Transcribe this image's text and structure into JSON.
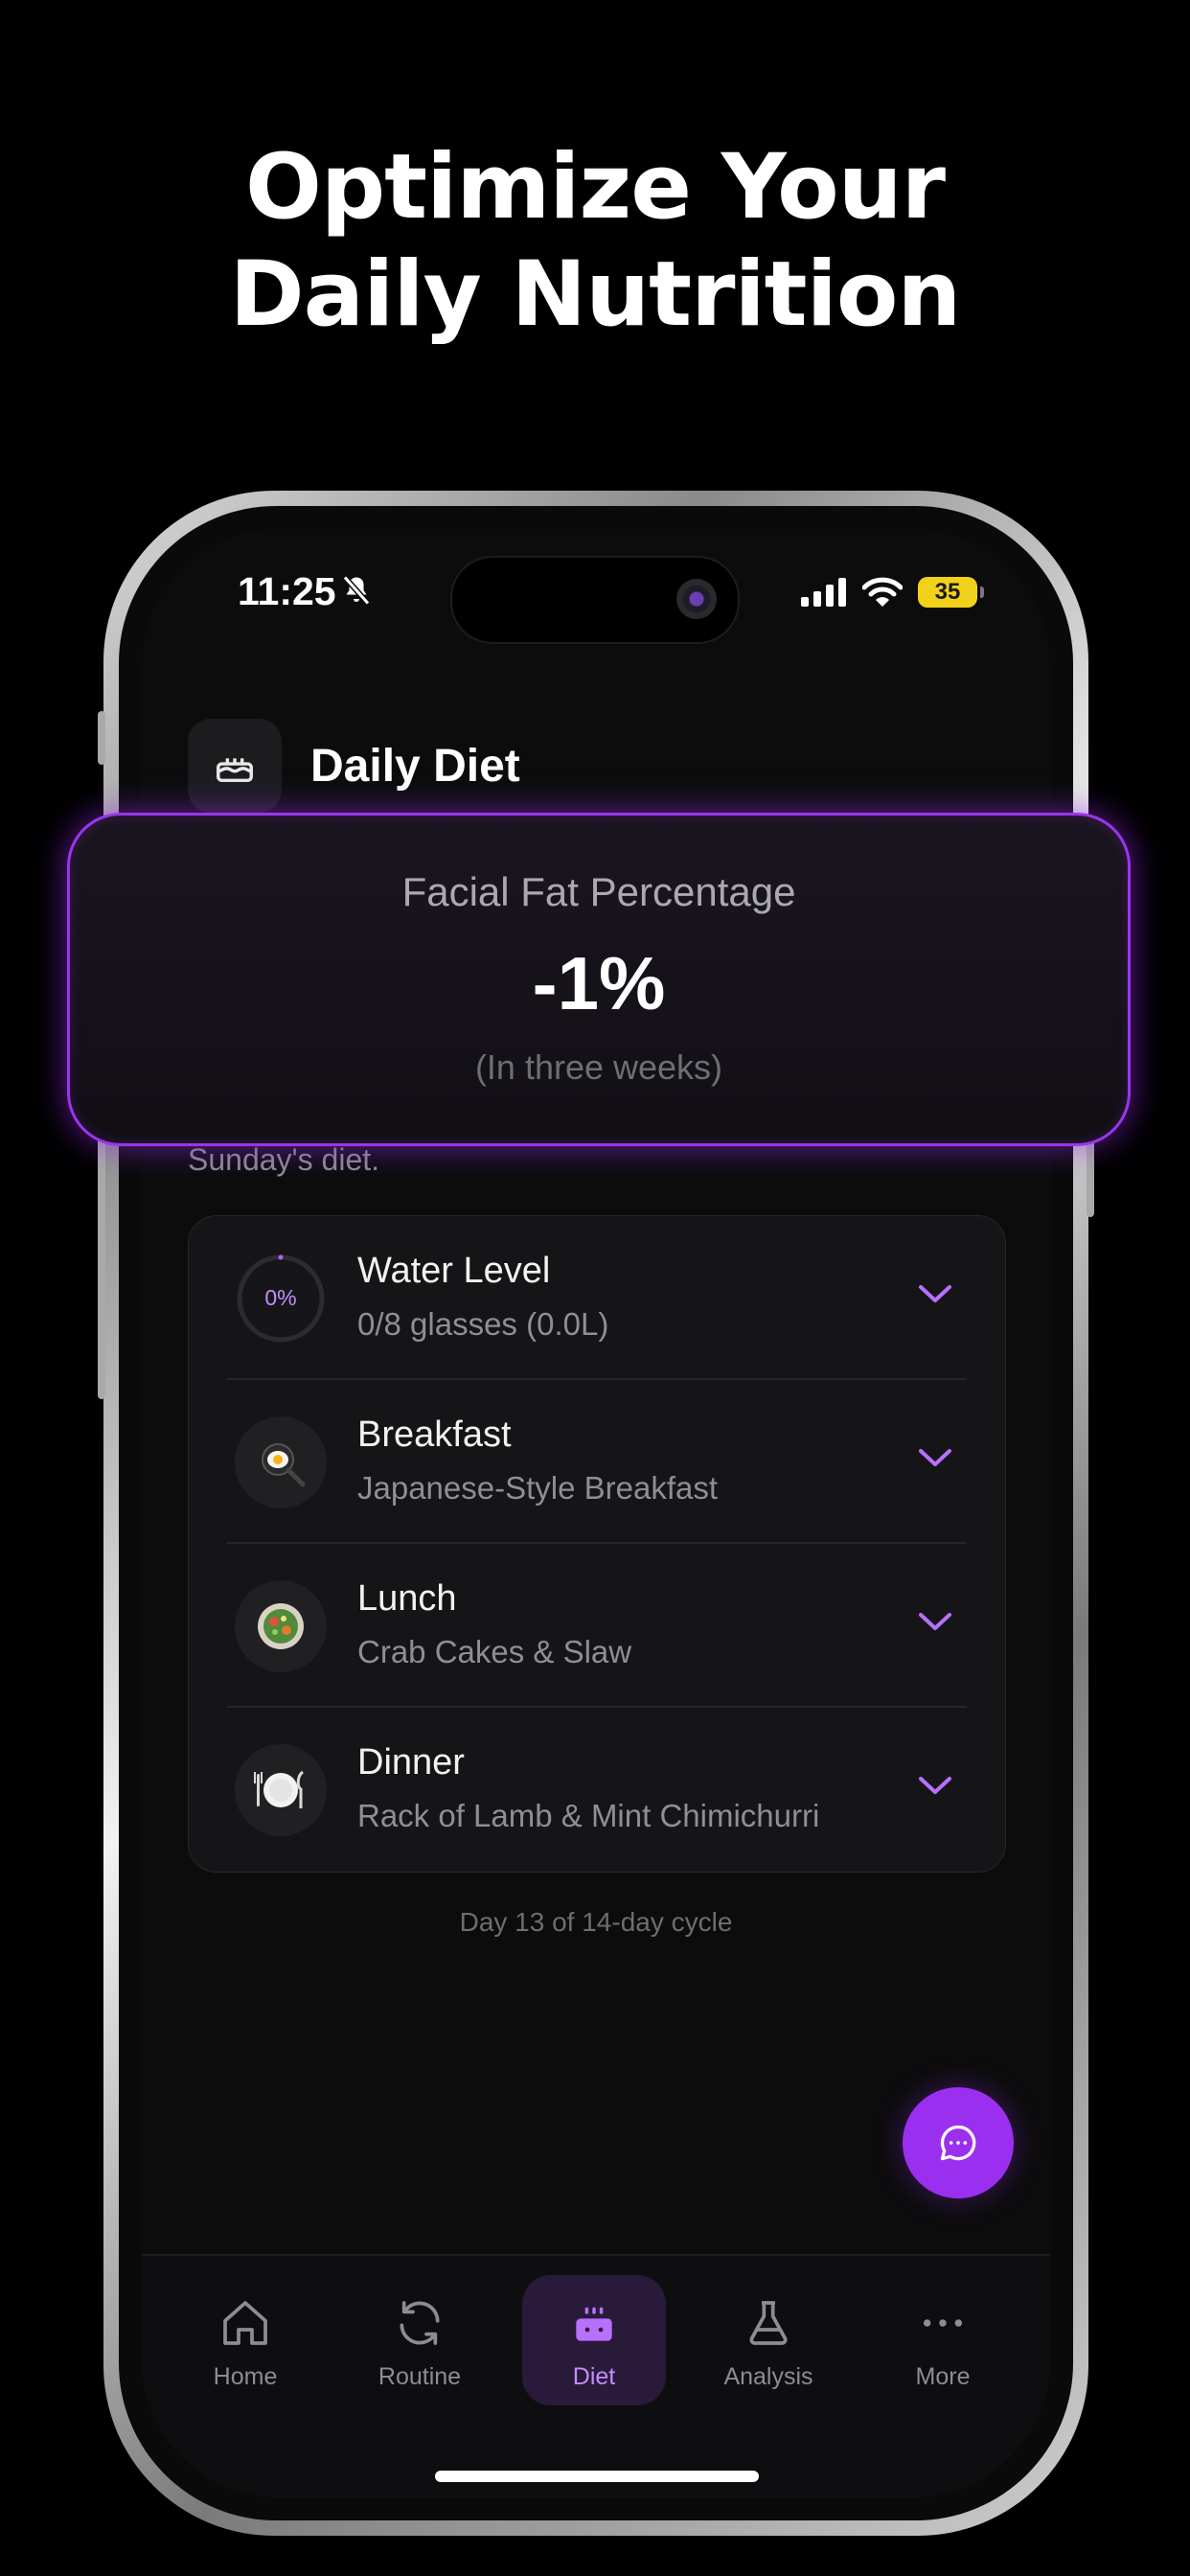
{
  "headline": {
    "line1": "Optimize Your",
    "line2": "Daily Nutrition"
  },
  "status_bar": {
    "time": "11:25",
    "battery": "35"
  },
  "page": {
    "title": "Daily Diet",
    "subtitle": "Sunday's diet."
  },
  "fat_card": {
    "title": "Facial Fat Percentage",
    "value": "-1%",
    "note": "(In three weeks)"
  },
  "meals": [
    {
      "label": "Water Level",
      "detail": "0/8 glasses (0.0L)",
      "progress_text": "0%",
      "progress": 0
    },
    {
      "label": "Breakfast",
      "detail": "Japanese-Style Breakfast",
      "icon": "fried-egg-pan-icon"
    },
    {
      "label": "Lunch",
      "detail": "Crab Cakes & Slaw",
      "icon": "salad-bowl-icon"
    },
    {
      "label": "Dinner",
      "detail": "Rack of Lamb & Mint Chimichurri",
      "icon": "plate-cutlery-icon"
    }
  ],
  "cycle_text": "Day 13 of 14-day cycle",
  "tabs": [
    {
      "label": "Home",
      "icon": "home-icon"
    },
    {
      "label": "Routine",
      "icon": "refresh-icon"
    },
    {
      "label": "Diet",
      "icon": "cake-icon",
      "active": true
    },
    {
      "label": "Analysis",
      "icon": "flask-icon"
    },
    {
      "label": "More",
      "icon": "more-dots-icon"
    }
  ],
  "colors": {
    "accent": "#9b2ff0",
    "accent_light": "#c48cff",
    "background": "#0c0c0d"
  }
}
